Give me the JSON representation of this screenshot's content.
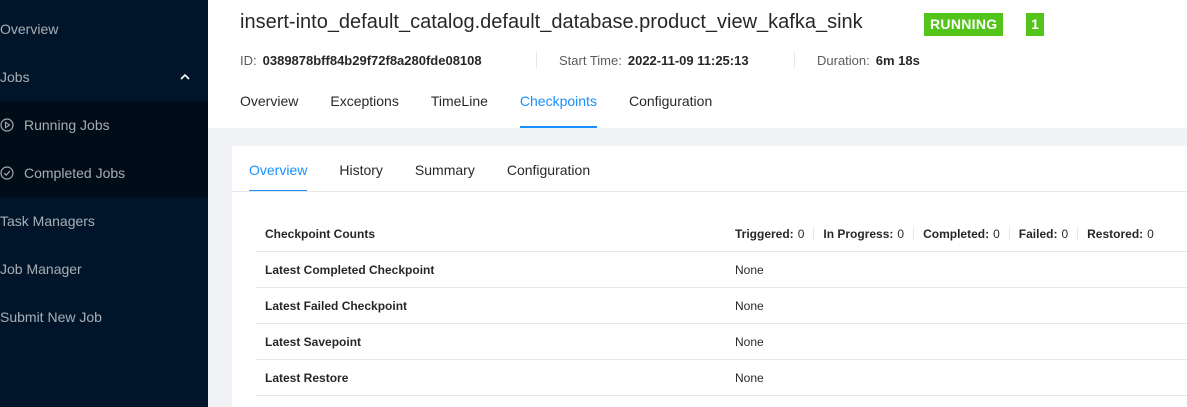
{
  "sidebar": {
    "items": [
      {
        "label": "Overview"
      },
      {
        "label": "Jobs"
      },
      {
        "label": "Running Jobs"
      },
      {
        "label": "Completed Jobs"
      },
      {
        "label": "Task Managers"
      },
      {
        "label": "Job Manager"
      },
      {
        "label": "Submit New Job"
      }
    ]
  },
  "job": {
    "title": "insert-into_default_catalog.default_database.product_view_kafka_sink",
    "status": "RUNNING",
    "count": "1",
    "id_label": "ID:",
    "id": "0389878bff84b29f72f8a280fde08108",
    "start_label": "Start Time:",
    "start": "2022-11-09 11:25:13",
    "duration_label": "Duration:",
    "duration": "6m 18s"
  },
  "tabs": [
    "Overview",
    "Exceptions",
    "TimeLine",
    "Checkpoints",
    "Configuration"
  ],
  "active_tab": "Checkpoints",
  "subtabs": [
    "Overview",
    "History",
    "Summary",
    "Configuration"
  ],
  "active_subtab": "Overview",
  "checkpoints": {
    "counts_label": "Checkpoint Counts",
    "counts": [
      {
        "label": "Triggered:",
        "value": "0"
      },
      {
        "label": "In Progress:",
        "value": "0"
      },
      {
        "label": "Completed:",
        "value": "0"
      },
      {
        "label": "Failed:",
        "value": "0"
      },
      {
        "label": "Restored:",
        "value": "0"
      }
    ],
    "rows": [
      {
        "label": "Latest Completed Checkpoint",
        "value": "None"
      },
      {
        "label": "Latest Failed Checkpoint",
        "value": "None"
      },
      {
        "label": "Latest Savepoint",
        "value": "None"
      },
      {
        "label": "Latest Restore",
        "value": "None"
      }
    ]
  },
  "colors": {
    "accent": "#1890ff",
    "status": "#52c41a",
    "sidebar": "#001529"
  }
}
